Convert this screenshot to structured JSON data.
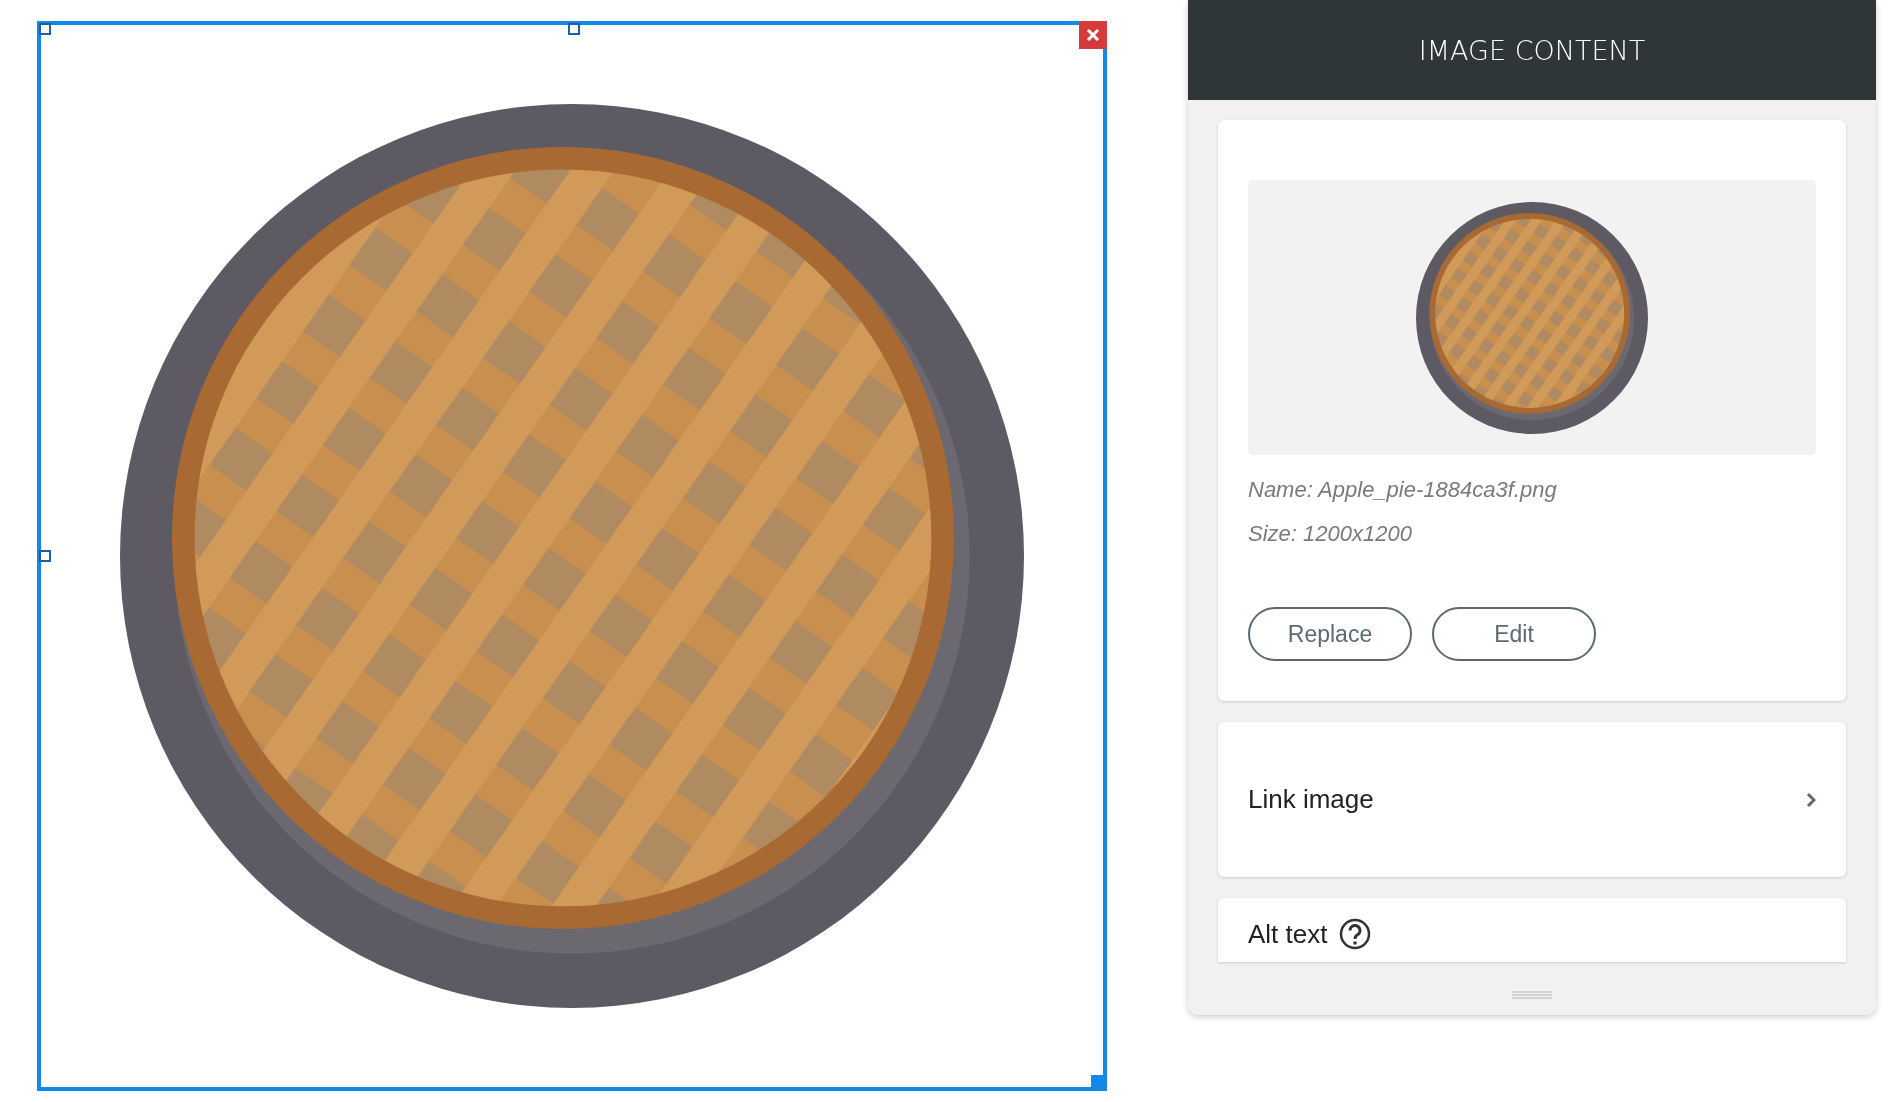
{
  "canvas": {
    "selected": true
  },
  "panel": {
    "title": "IMAGE CONTENT",
    "file_name": "Name: Apple_pie-1884ca3f.png",
    "file_size": "Size: 1200x1200",
    "buttons": [
      {
        "label": "Replace"
      },
      {
        "label": "Edit"
      }
    ],
    "rows": [
      {
        "kind": "link",
        "label": "Link image"
      },
      {
        "kind": "help",
        "label": "Alt text"
      }
    ]
  }
}
